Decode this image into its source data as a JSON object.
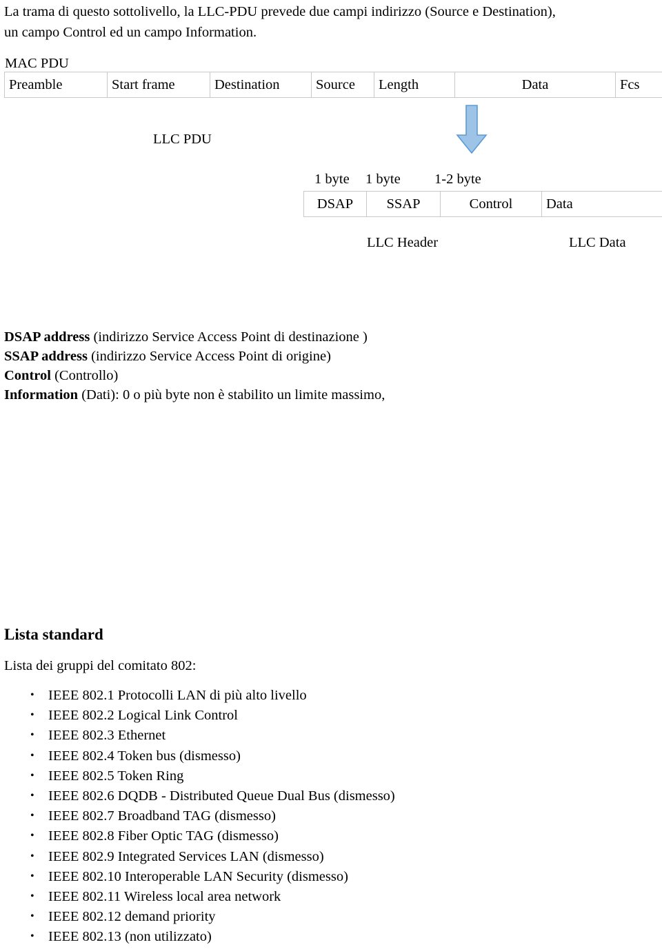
{
  "document": {
    "intro_paragraph": "La trama di questo sottolivello, la LLC-PDU prevede due campi indirizzo (Source e Destination),\nun campo Control ed un campo Information."
  },
  "mac_pdu": {
    "label": "MAC PDU",
    "fields": [
      "Preamble",
      "Start frame",
      "Destination",
      "Source",
      "Length",
      "Data",
      "Fcs"
    ]
  },
  "llc_pdu": {
    "label": "LLC PDU",
    "arrow_icon": "down-arrow-icon",
    "arrow_color": "#9DC3E6",
    "arrow_border_color": "#5B9BD5",
    "sizes": {
      "dsap": "1 byte",
      "ssap": "1 byte",
      "control": "1-2 byte"
    },
    "fields": [
      "DSAP",
      "SSAP",
      "Control",
      "Data"
    ],
    "footer": {
      "header_label": "LLC Header",
      "data_label": "LLC Data"
    }
  },
  "field_descriptions": [
    {
      "term": "DSAP address",
      "definition": " (indirizzo Service Access Point di destinazione )"
    },
    {
      "term": "SSAP address",
      "definition": " (indirizzo Service Access Point di origine)"
    },
    {
      "term": "Control",
      "definition": " (Controllo)"
    },
    {
      "term": "Information",
      "definition": " (Dati): 0 o più byte non è stabilito un limite massimo,"
    }
  ],
  "lista_standard": {
    "heading": "Lista standard",
    "subtitle": "Lista dei gruppi del comitato 802:",
    "items": [
      "IEEE 802.1 Protocolli LAN di più alto livello",
      "IEEE 802.2 Logical Link Control",
      "IEEE 802.3 Ethernet",
      "IEEE 802.4 Token bus (dismesso)",
      "IEEE 802.5 Token Ring",
      "IEEE 802.6 DQDB - Distributed Queue Dual Bus (dismesso)",
      "IEEE 802.7 Broadband TAG (dismesso)",
      "IEEE 802.8 Fiber Optic TAG (dismesso)",
      "IEEE 802.9 Integrated Services LAN (dismesso)",
      "IEEE 802.10 Interoperable LAN Security (dismesso)",
      "IEEE 802.11 Wireless local area network",
      "IEEE 802.12 demand priority",
      "IEEE 802.13 (non utilizzato)"
    ]
  }
}
